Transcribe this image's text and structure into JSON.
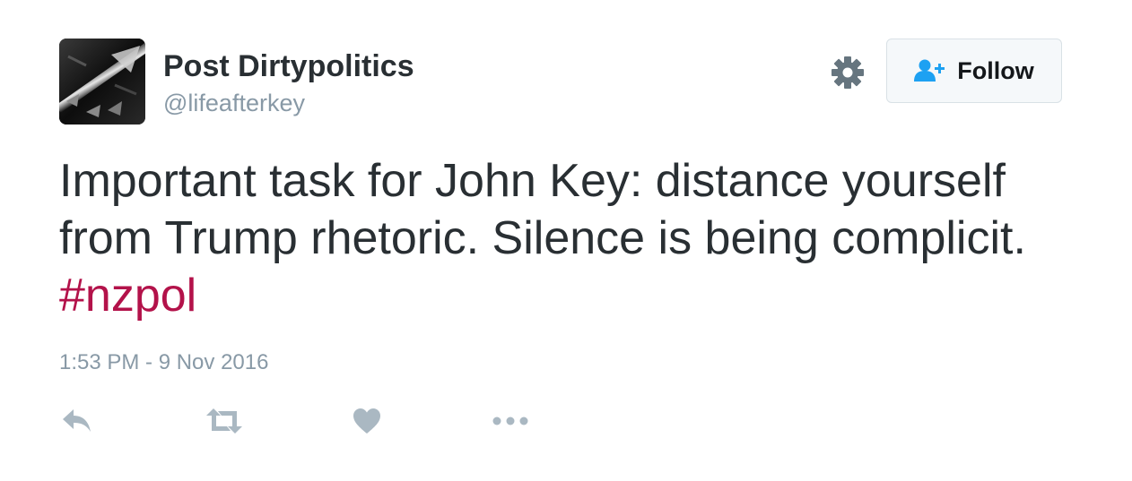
{
  "user": {
    "display_name": "Post Dirtypolitics",
    "screen_name": "@lifeafterkey",
    "avatar_icon": "arrows-avatar"
  },
  "header": {
    "settings_icon": "gear-icon",
    "follow_label": "Follow",
    "follow_icon": "add-user-icon"
  },
  "tweet": {
    "line1": "Important task for John Key: distance yourself",
    "line2": "from Trump rhetoric. Silence is being complicit.",
    "hashtag": "#nzpol",
    "timestamp": "1:53 PM - 9 Nov 2016"
  },
  "actions": {
    "reply_icon": "reply-icon",
    "retweet_icon": "retweet-icon",
    "like_icon": "heart-icon",
    "more_icon": "more-icon"
  },
  "colors": {
    "text": "#292f33",
    "muted": "#8899a6",
    "hashtag": "#b3124a",
    "follow_icon": "#1da1f2",
    "icon_gray": "#aab8c2",
    "gear": "#66757f"
  }
}
